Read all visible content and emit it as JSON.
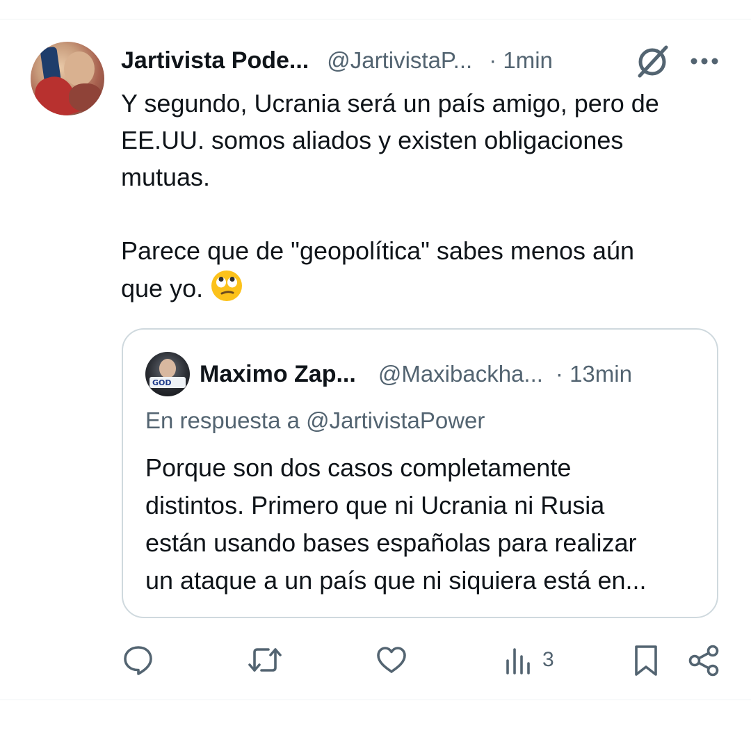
{
  "tweet": {
    "author_name": "Jartivista Pode...",
    "author_handle": "@JartivistaP...",
    "time": "· 1min",
    "text_paragraphs": [
      [
        "Y segundo, Ucrania será un país amigo, pero de",
        "EE.UU. somos aliados y existen obligaciones",
        "mutuas."
      ],
      [
        "Parece que de \"geopolítica\" sabes menos aún",
        "que yo."
      ]
    ],
    "emoji_icon": "face-with-rolling-eyes-emoji"
  },
  "quoted": {
    "author_name": "Maximo Zap...",
    "author_handle": "@Maxibackha...",
    "time": "· 13min",
    "reply_to": "En respuesta a @JartivistaPower",
    "text_lines": [
      "Porque son dos casos completamente",
      "distintos. Primero que ni Ucrania ni Rusia",
      "están usando bases españolas para realizar",
      "un ataque a un país que ni siquiera está en..."
    ]
  },
  "actions": {
    "reply_icon": "speech-bubble-icon",
    "retweet_icon": "retweet-arrows-icon",
    "like_icon": "heart-icon",
    "views_icon": "bar-chart-icon",
    "views_count": "3",
    "bookmark_icon": "bookmark-icon",
    "share_icon": "share-icon"
  },
  "colors": {
    "text": "#0f1419",
    "secondary": "#536471",
    "border": "#cfd9de"
  }
}
